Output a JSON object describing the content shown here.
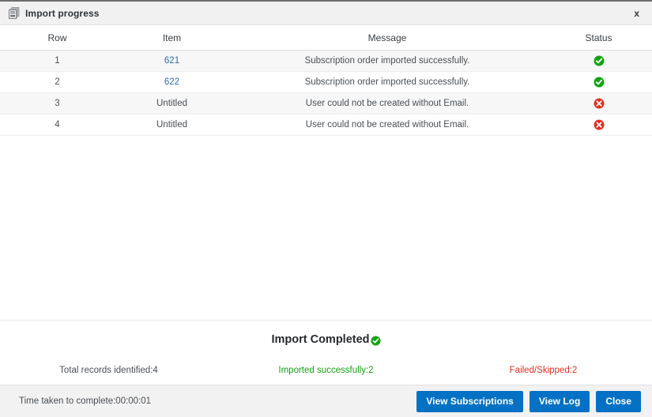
{
  "window": {
    "title": "Import progress",
    "title_icon": "document-stack-icon",
    "close_label": "x"
  },
  "table": {
    "columns": [
      "Row",
      "Item",
      "Message",
      "Status"
    ],
    "rows": [
      {
        "row": "1",
        "item": "621",
        "item_is_link": true,
        "message": "Subscription order imported successfully.",
        "status": "success"
      },
      {
        "row": "2",
        "item": "622",
        "item_is_link": true,
        "message": "Subscription order imported successfully.",
        "status": "success"
      },
      {
        "row": "3",
        "item": "Untitled",
        "item_is_link": false,
        "message": "User could not be created without Email.",
        "status": "error"
      },
      {
        "row": "4",
        "item": "Untitled",
        "item_is_link": false,
        "message": "User could not be created without Email.",
        "status": "error"
      }
    ]
  },
  "summary": {
    "title": "Import Completed",
    "title_status_icon": "success-check-icon",
    "total_records": "Total records identified:4",
    "imported_successfully": "Imported successfully:2",
    "failed_skipped": "Failed/Skipped:2"
  },
  "footer": {
    "time_taken": "Time taken to complete:00:00:01",
    "buttons": [
      {
        "label": "View Subscriptions",
        "name": "view-subscriptions-button"
      },
      {
        "label": "View Log",
        "name": "view-log-button"
      },
      {
        "label": "Close",
        "name": "close-button"
      }
    ]
  },
  "colors": {
    "accent_blue": "#0571c4",
    "link_blue": "#2e6ca4",
    "success_green": "#12a312",
    "error_red": "#e0301e",
    "titlebar_bg": "#f1f1f1",
    "row_stripe": "#f7f7f7",
    "footer_bg": "#f2f2f2"
  }
}
